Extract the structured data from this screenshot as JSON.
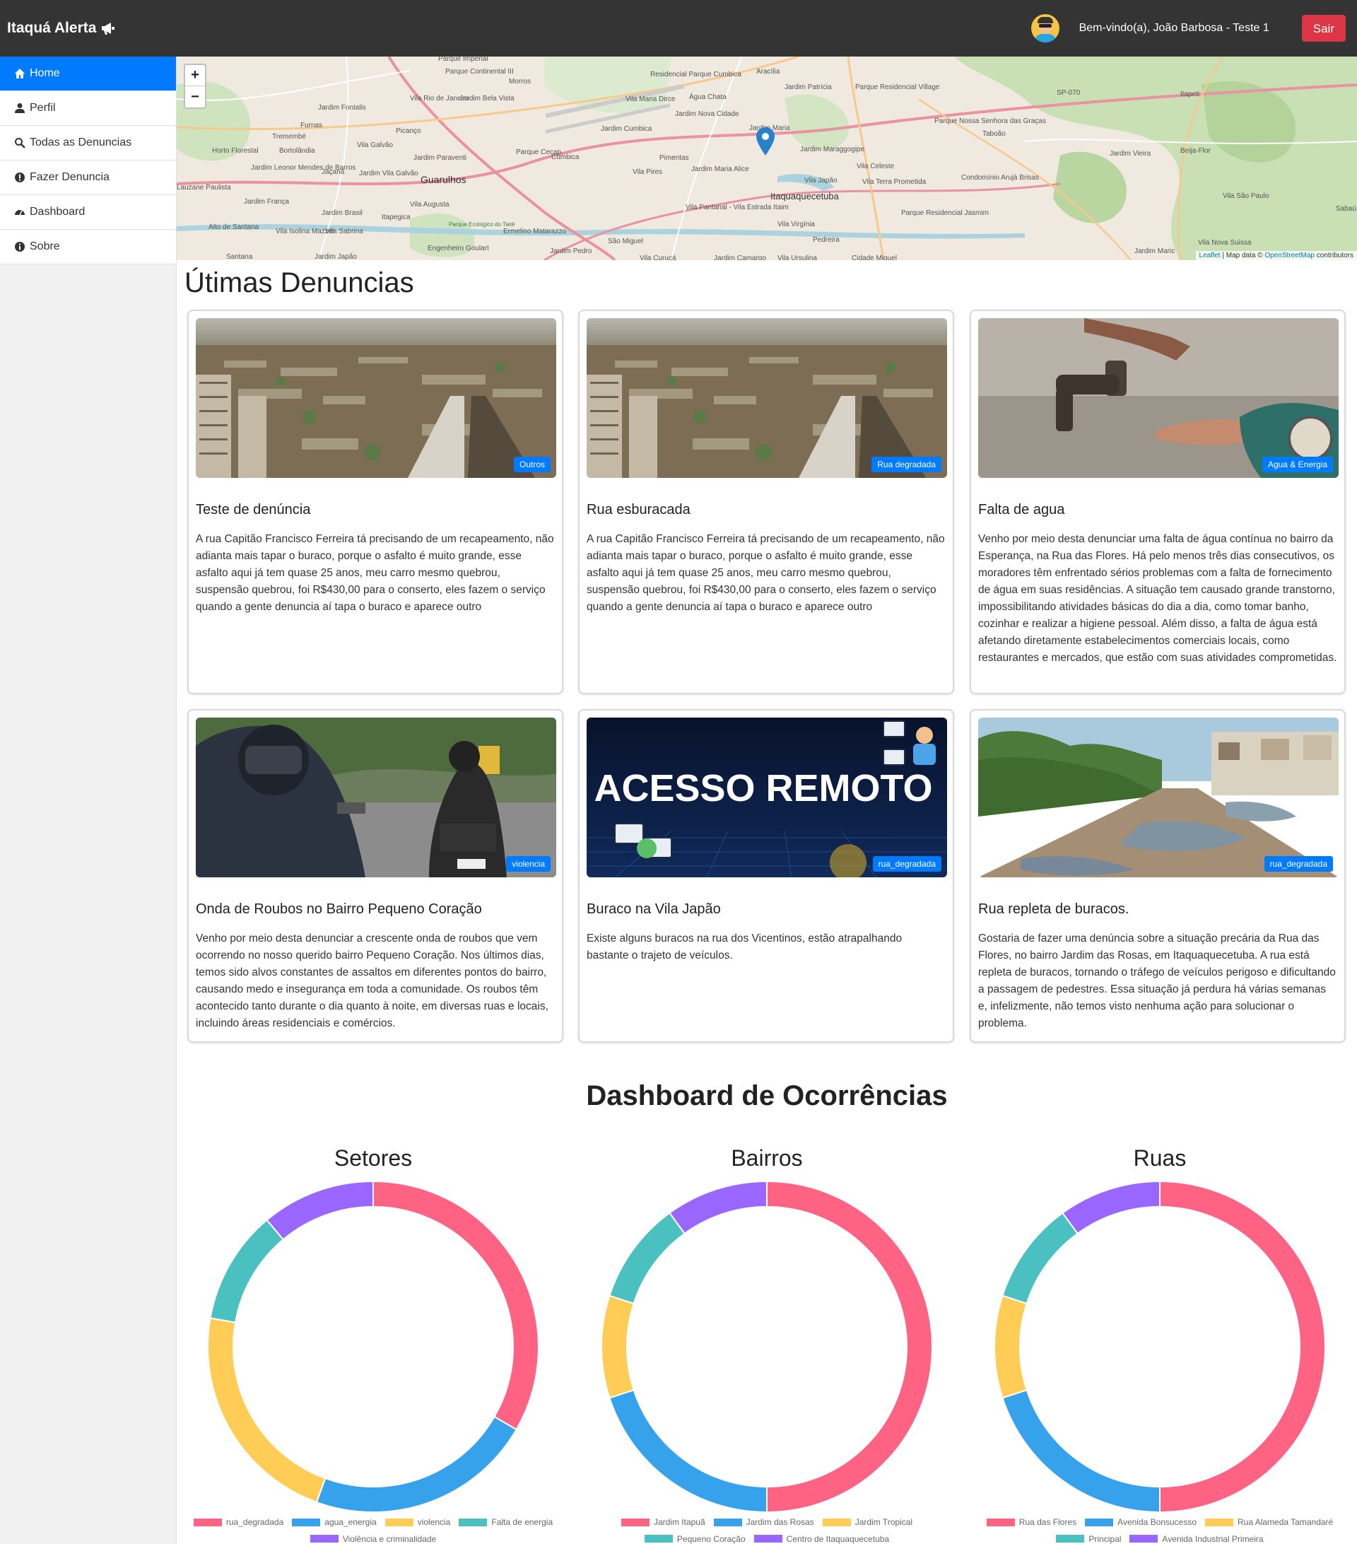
{
  "header": {
    "brand": "Itaquá Alerta",
    "welcome": "Bem-vindo(a), João Barbosa - Teste 1",
    "logout_label": "Sair"
  },
  "sidebar": {
    "items": [
      {
        "label": "Home",
        "icon": "home-icon",
        "active": true
      },
      {
        "label": "Perfil",
        "icon": "user-icon"
      },
      {
        "label": "Todas as Denuncias",
        "icon": "search-icon"
      },
      {
        "label": "Fazer Denuncia",
        "icon": "exclamation-icon"
      },
      {
        "label": "Dashboard",
        "icon": "dashboard-icon"
      },
      {
        "label": "Sobre",
        "icon": "info-icon"
      }
    ]
  },
  "map": {
    "zoom_in": "+",
    "zoom_out": "−",
    "attribution_leaflet": "Leaflet",
    "attribution_text": " | Map data © ",
    "attribution_osm": "OpenStreetMap",
    "attribution_suffix": " contributors",
    "labels": [
      "Parque Imperial",
      "Parque Continental III",
      "Morros",
      "Residencial Parque Cumbica",
      "Aracília",
      "Jardim Patrícia",
      "Parque Residencial Village",
      "SP-070",
      "Itapeti",
      "Jardim Fontalis",
      "Vila Rio de Janeiro",
      "Jardim Bela Vista",
      "Vila Maria Dirce",
      "Água Chata",
      "Jardim Nova Cidade",
      "Jardim Cumbica",
      "Jardim Maria",
      "Parque Nossa Senhora das Graças",
      "Taboão",
      "Furnas",
      "Picanço",
      "Tremembé",
      "Vila Galvão",
      "Parque Cecap",
      "Cumbica",
      "Jardim Maraggogipe",
      "Horto Florestal",
      "Bortolândia",
      "Jardim Paraventi",
      "Pimentas",
      "Jardim Vieira",
      "Beija-Flor",
      "Jardim Leonor Mendes de Barros",
      "Jaçanã",
      "Jardim Vila Galvão",
      "Guarulhos",
      "Vila Pires",
      "Jardim Maria Alice",
      "Vila Celeste",
      "Condomínio Arujá Brisas",
      "Vila Japão",
      "Vila Terra Prometida",
      "Lauzane Paulista",
      "Jardim França",
      "Itaquaquecetuba",
      "Vila São Paulo",
      "Jardim Brasil",
      "Vila Augusta",
      "Itapegica",
      "Parque Residencial Jasmim",
      "Alto de Santana",
      "Vila Isolina Mazzei",
      "Vila Sabrina",
      "Parque Ecológico do Tietê",
      "Ermelino Matarazzo",
      "Vila Pantanal - Vila Estrada Itaim",
      "Vila Virgínia",
      "Santana",
      "Jardim Japão",
      "Engenheiro Goulart",
      "São Miguel",
      "Jardim Pedro",
      "Vila Curuçá",
      "Jardim Camargo",
      "Vila Ursulina",
      "Cidade Miguel",
      "Pedreira",
      "Jardim Maric",
      "Vila Nova Suissa",
      "Sabaú"
    ]
  },
  "latest": {
    "title": "Útimas Denuncias",
    "cards": [
      {
        "badge": "Outros",
        "title": "Teste de denúncia",
        "desc": "A rua Capitão Francisco Ferreira tá precisando de um recapeamento, não adianta mais tapar o buraco, porque o asfalto é muito grande, esse asfalto aqui já tem quase 25 anos, meu carro mesmo quebrou, suspensão quebrou, foi R$430,00 para o conserto, eles fazem o serviço quando a gente denuncia aí tapa o buraco e aparece outro",
        "image": "city-aerial"
      },
      {
        "badge": "Rua degradada",
        "title": "Rua esburacada",
        "desc": "A rua Capitão Francisco Ferreira tá precisando de um recapeamento, não adianta mais tapar o buraco, porque o asfalto é muito grande, esse asfalto aqui já tem quase 25 anos, meu carro mesmo quebrou, suspensão quebrou, foi R$430,00 para o conserto, eles fazem o serviço quando a gente denuncia aí tapa o buraco e aparece outro",
        "image": "city-aerial"
      },
      {
        "badge": "Agua & Energia",
        "title": "Falta de agua",
        "desc": "Venho por meio desta denunciar uma falta de água contínua no bairro da Esperança, na Rua das Flores. Há pelo menos três dias consecutivos, os moradores têm enfrentado sérios problemas com a falta de fornecimento de água em suas residências. A situação tem causado grande transtorno, impossibilitando atividades básicas do dia a dia, como tomar banho, cozinhar e realizar a higiene pessoal. Além disso, a falta de água está afetando diretamente estabelecimentos comerciais locais, como restaurantes e mercados, que estão com suas atividades comprometidas.",
        "image": "faucet"
      },
      {
        "badge": "violencia",
        "title": "Onda de Roubos no Bairro Pequeno Coração",
        "desc": "Venho por meio desta denunciar a crescente onda de roubos que vem ocorrendo no nosso querido bairro Pequeno Coração. Nos últimos dias, temos sido alvos constantes de assaltos em diferentes pontos do bairro, causando medo e insegurança em toda a comunidade. Os roubos têm acontecido tanto durante o dia quanto à noite, em diversas ruas e locais, incluindo áreas residenciais e comércios.",
        "image": "motorcycle-robbery"
      },
      {
        "badge": "rua_degradada",
        "title": "Buraco na Vila Japão",
        "desc": "Existe alguns buracos na rua dos Vicentinos, estão atrapalhando bastante o trajeto de veículos.",
        "image": "acesso-remoto",
        "image_text": "ACESSO REMOTO"
      },
      {
        "badge": "rua_degradada",
        "title": "Rua repleta de buracos.",
        "desc": "Gostaria de fazer uma denúncia sobre a situação precária da Rua das Flores, no bairro Jardim das Rosas, em Itaquaquecetuba. A rua está repleta de buracos, tornando o tráfego de veículos perigoso e dificultando a passagem de pedestres. Essa situação já perdura há várias semanas e, infelizmente, não temos visto nenhuma ação para solucionar o problema.",
        "image": "flooded-road"
      }
    ]
  },
  "dashboard": {
    "title": "Dashboard de Ocorrências"
  },
  "chart_data": [
    {
      "type": "doughnut",
      "title": "Setores",
      "categories": [
        "rua_degradada",
        "agua_energia",
        "violencia",
        "Falta de energia",
        "Violência e criminalidade"
      ],
      "values": [
        3,
        2,
        2,
        1,
        1
      ],
      "colors": [
        "#ff6384",
        "#36a2eb",
        "#ffcd56",
        "#4bc0c0",
        "#9966ff"
      ]
    },
    {
      "type": "doughnut",
      "title": "Bairros",
      "categories": [
        "Jardim Itapuã",
        "Jardim das Rosas",
        "Jardim Tropical",
        "Pequeno Coração",
        "Centro de Itaquaquecetuba"
      ],
      "values": [
        5,
        2,
        1,
        1,
        1
      ],
      "colors": [
        "#ff6384",
        "#36a2eb",
        "#ffcd56",
        "#4bc0c0",
        "#9966ff"
      ]
    },
    {
      "type": "doughnut",
      "title": "Ruas",
      "categories": [
        "Rua das Flores",
        "Avenida Bonsucesso",
        "Rua Alameda Tamandaré",
        "Principal",
        "Avenida Industrial Primeira"
      ],
      "values": [
        5,
        2,
        1,
        1,
        1
      ],
      "colors": [
        "#ff6384",
        "#36a2eb",
        "#ffcd56",
        "#4bc0c0",
        "#9966ff"
      ]
    }
  ]
}
